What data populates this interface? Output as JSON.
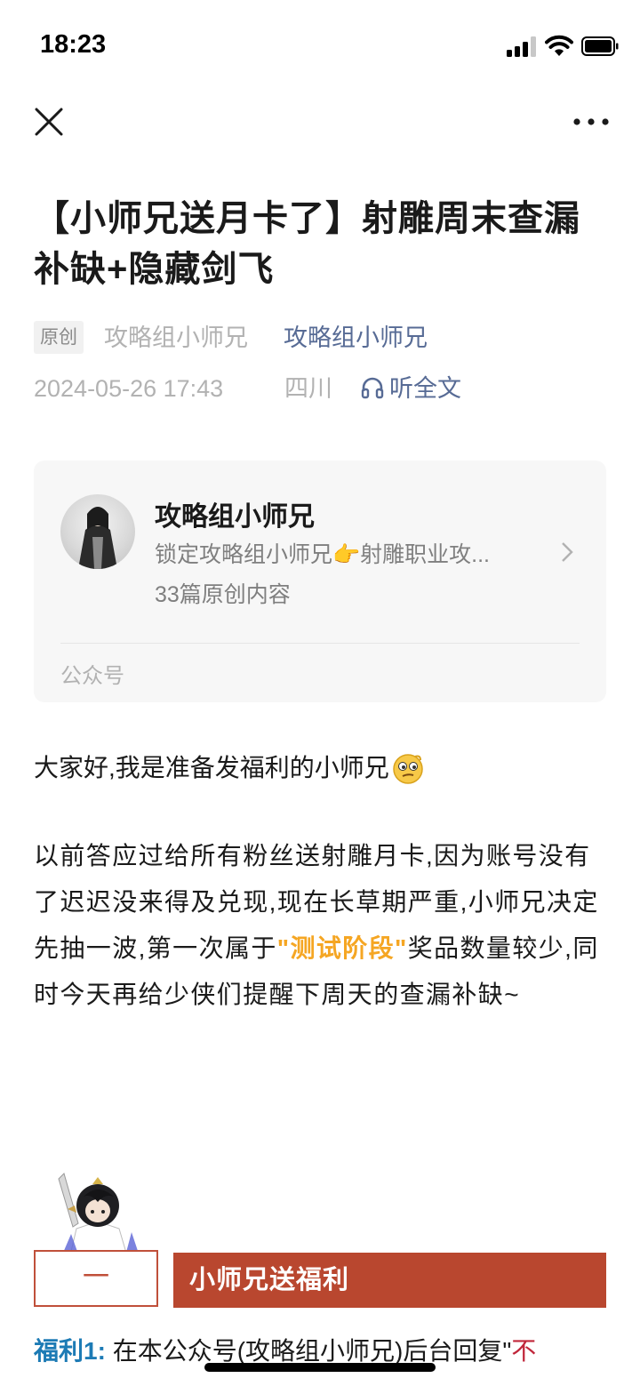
{
  "status_bar": {
    "time": "18:23"
  },
  "nav": {
    "close_icon": "close-icon",
    "more_icon": "more-icon"
  },
  "article": {
    "title": "【小师兄送月卡了】射雕周末查漏补缺+隐藏剑飞",
    "original_tag": "原创",
    "author_plain": "攻略组小师兄",
    "author_link": "攻略组小师兄",
    "date": "2024-05-26 17:43",
    "region": "四川",
    "listen_label": "听全文"
  },
  "profile_card": {
    "name": "攻略组小师兄",
    "description": "锁定攻略组小师兄👉射雕职业攻...",
    "count": "33篇原创内容",
    "type": "公众号"
  },
  "body": {
    "greeting": "大家好,我是准备发福利的小师兄",
    "para_part1": " 以前答应过给所有粉丝送射雕月卡,因为账号没有了迟迟没来得及兑现,现在长草期严重,小师兄决定先抽一波,第一次属于",
    "para_highlight": "\"测试阶段\"",
    "para_part2": "奖品数量较少,同时今天再给少侠们提醒下周天的查漏补缺~"
  },
  "section": {
    "number": "一",
    "title": "小师兄送福利"
  },
  "benefit": {
    "label": "福利1:",
    "text": "在本公众号(攻略组小师兄)后台回复\"",
    "red_text": "不"
  },
  "colors": {
    "link": "#576b95",
    "accent_orange": "#f5a623",
    "section_red": "#b9472f",
    "benefit_blue": "#1d7bb5"
  }
}
